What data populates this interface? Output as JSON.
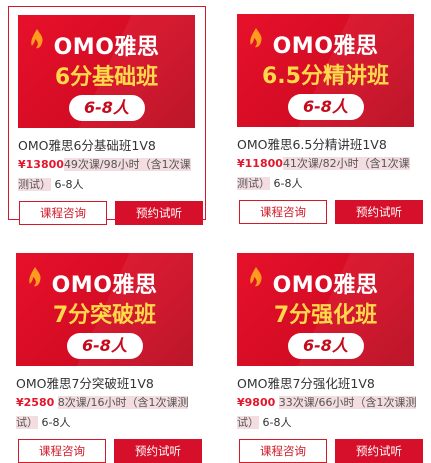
{
  "courses": [
    {
      "banner_title": "OMO雅思",
      "banner_subtitle": "6分基础班",
      "banner_pill": "6-8人",
      "name": "OMO雅思6分基础班1V8",
      "price": "¥13800",
      "details_a": "49次课/98小时（含1次课",
      "details_b": "测试）",
      "class_size": "6-8人",
      "consult_label": "课程咨询",
      "trial_label": "预约试听"
    },
    {
      "banner_title": "OMO雅思",
      "banner_subtitle": "6.5分精讲班",
      "banner_pill": "6-8人",
      "name": "OMO雅思6.5分精讲班1V8",
      "price": "¥11800",
      "details_a": "41次课/82小时（含1次课",
      "details_b": "测试）",
      "class_size": "6-8人",
      "consult_label": "课程咨询",
      "trial_label": "预约试听"
    },
    {
      "banner_title": "OMO雅思",
      "banner_subtitle": "7分突破班",
      "banner_pill": "6-8人",
      "name": "OMO雅思7分突破班1V8",
      "price": "¥2580",
      "details_a": "8次课/16小时（含1次课测",
      "details_b": "试）",
      "class_size": "6-8人",
      "consult_label": "课程咨询",
      "trial_label": "预约试听"
    },
    {
      "banner_title": "OMO雅思",
      "banner_subtitle": "7分强化班",
      "banner_pill": "6-8人",
      "name": "OMO雅思7分强化班1V8",
      "price": "¥9800",
      "details_a": "33次课/66小时（含1次课测",
      "details_b": "试）",
      "class_size": "6-8人",
      "consult_label": "课程咨询",
      "trial_label": "预约试听"
    }
  ],
  "colors": {
    "accent": "#d6102a",
    "price": "#e3162c",
    "subtitle": "#ffd94a"
  }
}
